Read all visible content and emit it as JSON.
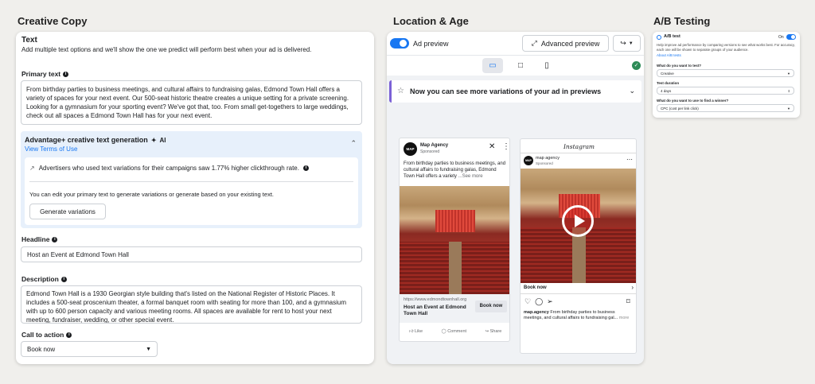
{
  "sections": {
    "creative_copy": "Creative Copy",
    "location_age": "Location & Age",
    "ab_testing": "A/B Testing"
  },
  "creative": {
    "text_heading": "Text",
    "text_sub": "Add multiple text options and we'll show the one we predict will perform best when your ad is delivered.",
    "primary_label": "Primary text",
    "primary_value": "From birthday parties to business meetings, and cultural affairs to fundraising galas, Edmond Town Hall offers a variety of spaces for your next event. Our 500-seat historic theatre creates a unique setting for a private screening. Looking for a gymnasium for your sporting event? We've got that, too. From small get-togethers to large weddings, check out all spaces a Edmond Town Hall has for your next event.",
    "advantage_title": "Advantage+ creative text generation",
    "advantage_ai": "AI",
    "view_terms": "View Terms of Use",
    "stat_text": "Advertisers who used text variations for their campaigns saw 1.77% higher clickthrough rate.",
    "edit_hint": "You can edit your primary text to generate variations or generate based on your existing text.",
    "generate_btn": "Generate variations",
    "headline_label": "Headline",
    "headline_value": "Host an Event at Edmond Town Hall",
    "description_label": "Description",
    "description_value": "Edmond Town Hall is a 1930 Georgian style building that's listed on the National Register of Historic Places. It includes a 500-seat proscenium theater, a formal banquet room with seating for more than 100, and a gymnasium with up to 600 person capacity and various meeting rooms. All spaces are available for rent to host your next meeting, fundraiser, wedding, or other special event.",
    "cta_label": "Call to action",
    "cta_value": "Book now"
  },
  "preview": {
    "ad_preview": "Ad preview",
    "advanced_preview": "Advanced preview",
    "banner": "Now you can see more variations of your ad in previews",
    "fb": {
      "page_name": "Map Agency",
      "sponsored": "Sponsored",
      "text": "From birthday parties to business meetings, and cultural affairs to fundraising galas, Edmond Town Hall offers a variety",
      "see_more": "...See more",
      "url": "https://www.edmondtownhall.org",
      "headline": "Host an Event at Edmond Town Hall",
      "cta": "Book now",
      "like": "Like",
      "comment": "Comment",
      "share": "Share",
      "logo": "MAP"
    },
    "ig": {
      "brand": "Instagram",
      "page_name": "map agency",
      "sponsored": "Sponsored",
      "cta": "Book now",
      "caption_user": "map.agency",
      "caption": "From birthday parties to business meetings, and cultural affairs to fundraising gal...",
      "more": "more"
    }
  },
  "ab": {
    "title": "A/B test",
    "on": "On",
    "desc": "Help improve ad performance by comparing versions to see what works best. For accuracy, each one will be shown to separate groups of your audience.",
    "about": "About A/B tests",
    "q1": "What do you want to test?",
    "q1_value": "Creative",
    "q2": "Test duration",
    "q2_value": "4 days",
    "q3": "What do you want to use to find a winner?",
    "q3_value": "CPC (cost per link click)"
  },
  "colors": {
    "accent": "#1877f2",
    "background": "#f0efec",
    "advantage_bg": "#e7f0fb"
  }
}
